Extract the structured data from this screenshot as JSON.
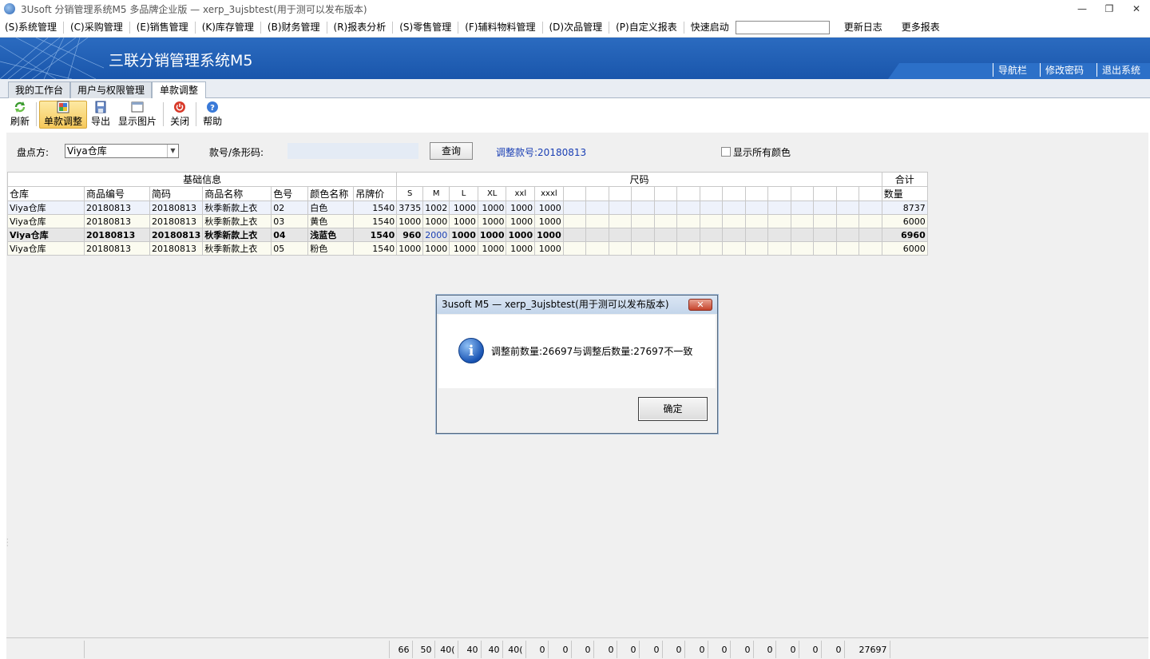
{
  "window": {
    "title": "3Usoft 分销管理系统M5 多品牌企业版 — xerp_3ujsbtest(用于测可以发布版本)",
    "controls": [
      "—",
      "❐",
      "✕"
    ]
  },
  "menu": {
    "items": [
      "(S)系统管理",
      "(C)采购管理",
      "(E)销售管理",
      "(K)库存管理",
      "(B)财务管理",
      "(R)报表分析",
      "(S)零售管理",
      "(F)辅料物料管理",
      "(D)次品管理",
      "(P)自定义报表"
    ],
    "quick_launch_label": "快速启动",
    "quick_launch_value": "",
    "update_log": "更新日志",
    "more_reports": "更多报表"
  },
  "banner": {
    "title": "三联分销管理系统M5",
    "links": [
      "导航栏",
      "修改密码",
      "退出系统"
    ]
  },
  "tabs": [
    "我的工作台",
    "用户与权限管理",
    "单款调整"
  ],
  "active_tab": "单款调整",
  "toolbar": {
    "refresh": "刷新",
    "adjust": "单款调整",
    "export": "导出",
    "show_image": "显示图片",
    "close": "关闭",
    "help": "帮助"
  },
  "filter": {
    "warehouse_label": "盘点方:",
    "warehouse_value": "Viya仓库",
    "code_label": "款号/条形码:",
    "code_value": "",
    "query_button": "查询",
    "adjust_code_label": "调整款号:20180813",
    "show_all_colors": "显示所有颜色",
    "show_all_colors_checked": false
  },
  "grid": {
    "groups": {
      "basic": "基础信息",
      "size": "尺码",
      "total": "合计"
    },
    "columns": [
      "仓库",
      "商品编号",
      "简码",
      "商品名称",
      "色号",
      "颜色名称",
      "吊牌价"
    ],
    "sizes": [
      "S",
      "M",
      "L",
      "XL",
      "xxl",
      "xxxl"
    ],
    "total_column": "数量",
    "rows": [
      {
        "warehouse": "Viya仓库",
        "item_no": "20180813",
        "short_code": "20180813",
        "name": "秋季新款上衣",
        "color_no": "02",
        "color_name": "白色",
        "price": "1540",
        "sizes": [
          "3735",
          "1002",
          "1000",
          "1000",
          "1000",
          "1000"
        ],
        "total": "8737"
      },
      {
        "warehouse": "Viya仓库",
        "item_no": "20180813",
        "short_code": "20180813",
        "name": "秋季新款上衣",
        "color_no": "03",
        "color_name": "黄色",
        "price": "1540",
        "sizes": [
          "1000",
          "1000",
          "1000",
          "1000",
          "1000",
          "1000"
        ],
        "total": "6000"
      },
      {
        "warehouse": "Viya仓库",
        "item_no": "20180813",
        "short_code": "20180813",
        "name": "秋季新款上衣",
        "color_no": "04",
        "color_name": "浅蓝色",
        "price": "1540",
        "sizes": [
          "960",
          "2000",
          "1000",
          "1000",
          "1000",
          "1000"
        ],
        "total": "6960"
      },
      {
        "warehouse": "Viya仓库",
        "item_no": "20180813",
        "short_code": "20180813",
        "name": "秋季新款上衣",
        "color_no": "05",
        "color_name": "粉色",
        "price": "1540",
        "sizes": [
          "1000",
          "1000",
          "1000",
          "1000",
          "1000",
          "1000"
        ],
        "total": "6000"
      }
    ],
    "footer_totals": [
      "66",
      "50",
      "40(",
      "40",
      "40",
      "40(",
      "0",
      "0",
      "0",
      "0",
      "0",
      "0",
      "0",
      "0",
      "0",
      "0",
      "0",
      "0",
      "0",
      "0"
    ],
    "footer_grand_total": "27697"
  },
  "dialog": {
    "title": "3usoft M5 — xerp_3ujsbtest(用于测可以发布版本)",
    "close": "✕",
    "message": "调整前数量:26697与调整后数量:27697不一致",
    "ok": "确定"
  },
  "colors": {
    "banner": "#1a56ab",
    "adjust_code_text": "#1a3fb4",
    "highlight_value": "#1a3fb4"
  }
}
